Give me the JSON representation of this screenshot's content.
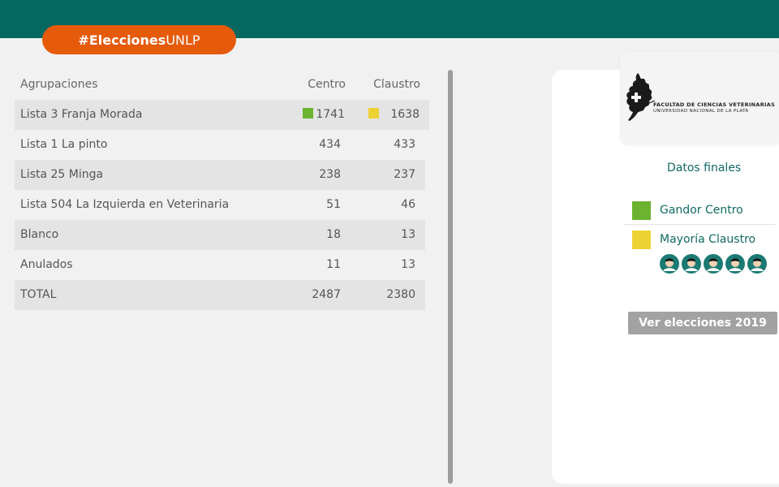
{
  "header": {
    "hashtag_bold": "#Elecciones",
    "hashtag_rest": "UNLP",
    "bar_color": "#066861",
    "accent_color": "#e65a0c"
  },
  "table": {
    "headers": {
      "name": "Agrupaciones",
      "centro": "Centro",
      "claustro": "Claustro"
    },
    "rows": [
      {
        "name": "Lista 3 Franja Morada",
        "centro": "1741",
        "claustro": "1638"
      },
      {
        "name": "Lista 1 La pinto",
        "centro": "434",
        "claustro": "433"
      },
      {
        "name": "Lista 25 Minga",
        "centro": "238",
        "claustro": "237"
      },
      {
        "name": "Lista 504 La Izquierda en Veterinaria",
        "centro": "51",
        "claustro": "46"
      },
      {
        "name": "Blanco",
        "centro": "18",
        "claustro": "13"
      },
      {
        "name": "Anulados",
        "centro": "11",
        "claustro": "13"
      },
      {
        "name": "TOTAL",
        "centro": "2487",
        "claustro": "2380"
      }
    ]
  },
  "sidebar": {
    "logo_line1": "FACULTAD DE CIENCIAS VETERINARIAS",
    "logo_line2": "UNIVERSIDAD NACIONAL DE LA PLATA",
    "datos_title": "Datos finales",
    "legend": [
      {
        "label": "Gandor Centro",
        "color": "#6cb32f"
      },
      {
        "label": "Mayoría Claustro",
        "color": "#ecd233"
      }
    ],
    "avatar_count": 5,
    "button_label": "Ver elecciones 2019"
  }
}
